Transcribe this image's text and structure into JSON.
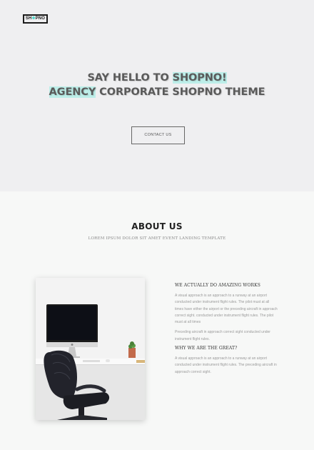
{
  "header": {
    "logo_text": "SH",
    "logo_text2": "PNO"
  },
  "hero": {
    "line1_a": "SAY HELLO TO ",
    "line1_b": "SHOPNO!",
    "line2_a": "AGENCY",
    "line2_b": " CORPORATE SHOPNO THEME",
    "button_label": "CONTACT US"
  },
  "about": {
    "title": "ABOUT US",
    "subtitle": "LOREM IPSUM DOLOR SIT AMET EVENT LANDING TEMPLATE",
    "heading1": "WE ACTUALLY DO AMAZING WORKS",
    "para1": "A visual approach is an approach to a runway at an airport conducted under instrument flight rules. The pilot must at all times have either the airport or the preceding aircraft in approach correct sight. conducted under instrument flight rules. The pilot must at all times",
    "para2": "Preceding aircraft in approach correct sight conducted under instrument flight rules.",
    "heading2": "WHY WE ARE THE GREAT?",
    "para3": "A visual approach is an approach to a runway at an airport conducted under instrument flight rules. The preceding aircraft in approach correct sight."
  },
  "colors": {
    "accent": "#58d5c9",
    "highlight": "#bdeee9",
    "hero_bg": "#efeff1"
  }
}
